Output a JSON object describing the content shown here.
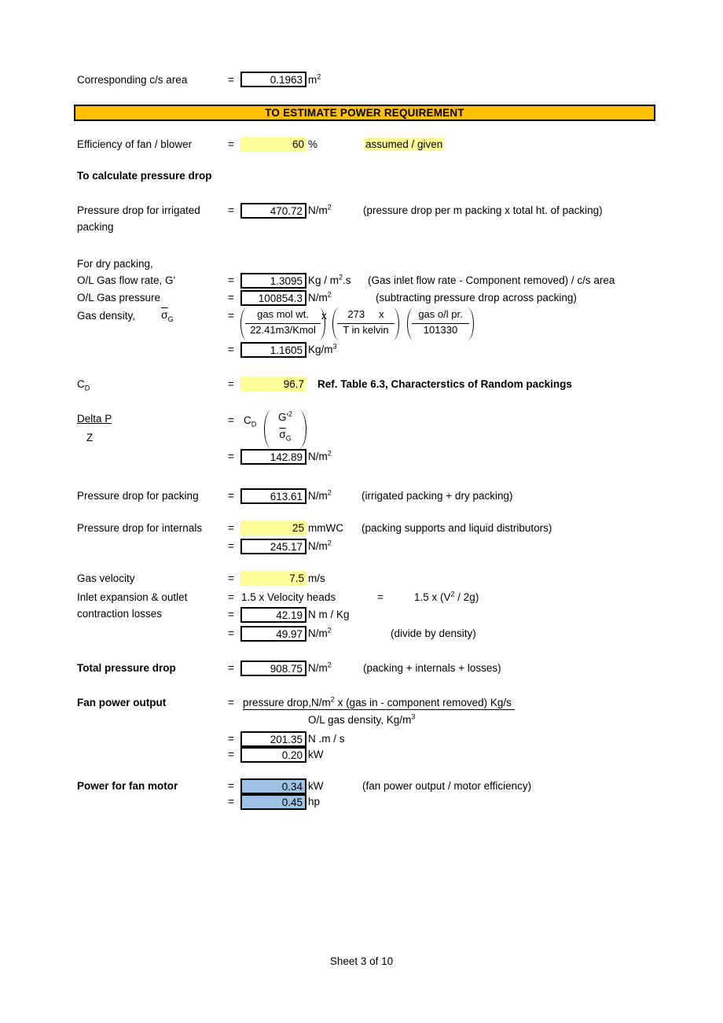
{
  "sheet": {
    "footer": "Sheet 3 of 10"
  },
  "cs_area": {
    "label": "Corresponding c/s area",
    "eq": "=",
    "value": "0.1963",
    "unit_base": "m",
    "unit_sup": "2"
  },
  "banner": {
    "title": "TO ESTIMATE POWER REQUIREMENT",
    "bg_color": "#FFC000"
  },
  "efficiency": {
    "label": "Efficiency of fan / blower",
    "eq": "=",
    "value": "60",
    "unit": "%",
    "note": "assumed / given",
    "highlight_color": "#FFFF99"
  },
  "pressure_drop_heading": "To calculate pressure drop",
  "irrigated": {
    "label_line1": "Pressure drop for irrigated",
    "label_line2": "packing",
    "eq": "=",
    "value": "470.72",
    "unit_base": "N/m",
    "unit_sup": "2",
    "comment": "(pressure drop per m packing  x total ht. of packing)"
  },
  "dry_packing": {
    "heading": "For dry packing,",
    "gas_flow": {
      "label": "O/L Gas flow rate, G'",
      "eq": "=",
      "value": "1.3095",
      "unit_pre": "Kg / m",
      "unit_sup": "2",
      "unit_post": ".s",
      "comment": "(Gas inlet flow rate - Component removed) / c/s area"
    },
    "gas_pressure": {
      "label": "O/L Gas pressure",
      "eq": "=",
      "value": "100854.3",
      "unit_base": "N/m",
      "unit_sup": "2",
      "comment": "(subtracting pressure drop across packing)"
    },
    "gas_density": {
      "label": "Gas density,",
      "symbol": "σ",
      "symbol_sub": "G",
      "eq1": "=",
      "term1_num": "gas mol wt.",
      "term1_den": "22.41m3/Kmol",
      "mult1": "x",
      "term2_num": "273",
      "term2_num_x": "x",
      "term2_den": "T in kelvin",
      "term3_num": "gas o/l pr.",
      "term3_den": "101330",
      "eq2": "=",
      "value": "1.1605",
      "unit_base": "Kg/m",
      "unit_sup": "3"
    }
  },
  "cd": {
    "label_base": "C",
    "label_sub": "D",
    "eq": "=",
    "value": "96.7",
    "comment": "Ref. Table 6.3, Characterstics of Random packings",
    "highlight_color": "#FFFF99"
  },
  "delta_p": {
    "num_label": "Delta P",
    "den_label": "Z",
    "eq1": "=",
    "cd_base": "C",
    "cd_sub": "D",
    "frac_num_base": "G'",
    "frac_num_sup": "2",
    "frac_den_base": "σ",
    "frac_den_sub": "G",
    "eq2": "=",
    "value": "142.89",
    "unit_base": "N/m",
    "unit_sup": "2"
  },
  "packing_drop": {
    "label": "Pressure drop for packing",
    "eq": "=",
    "value": "613.61",
    "unit_base": "N/m",
    "unit_sup": "2",
    "comment": "(irrigated packing + dry packing)"
  },
  "internals_drop": {
    "label": "Pressure drop for internals",
    "eq1": "=",
    "value1": "25",
    "unit1": "mmWC",
    "comment": "(packing supports and liquid distributors)",
    "eq2": "=",
    "value2": "245.17",
    "unit2_base": "N/m",
    "unit2_sup": "2",
    "highlight_color": "#FFFF99"
  },
  "gas_velocity": {
    "label": "Gas velocity",
    "eq": "=",
    "value": "7.5",
    "unit": "m/s",
    "highlight_color": "#FFFF99"
  },
  "losses": {
    "label_line1": "Inlet expansion & outlet",
    "label_line2": "contraction losses",
    "eq1": "=",
    "expr1": "1.5 x Velocity heads",
    "eq_mid": "=",
    "expr2_pre": "1.5 x (V",
    "expr2_sup": "2",
    "expr2_post": " / 2g)",
    "eq2": "=",
    "value1": "42.19",
    "unit1": "N m / Kg",
    "eq3": "=",
    "value2": "49.97",
    "unit2_base": "N/m",
    "unit2_sup": "2",
    "comment": "(divide by density)"
  },
  "total_drop": {
    "label": "Total pressure drop",
    "eq": "=",
    "value": "908.75",
    "unit_base": "N/m",
    "unit_sup": "2",
    "comment": "(packing + internals + losses)"
  },
  "fan_power": {
    "label": "Fan power output",
    "eq1": "=",
    "formula_num_pre": "pressure drop,N/m",
    "formula_num_sup": "2",
    "formula_num_post": " x (gas in - component removed) Kg/s",
    "formula_den_pre": "O/L gas density, Kg/m",
    "formula_den_sup": "3",
    "eq2": "=",
    "value1": "201.35",
    "unit1": "N .m / s",
    "eq3": "=",
    "value2": "0.20",
    "unit2": "kW"
  },
  "motor_power": {
    "label": "Power for fan motor",
    "eq1": "=",
    "value1": "0.34",
    "unit1": "kW",
    "comment": "(fan power output / motor efficiency)",
    "eq2": "=",
    "value2": "0.45",
    "unit2": "hp",
    "highlight_color": "#9DC3E6"
  }
}
